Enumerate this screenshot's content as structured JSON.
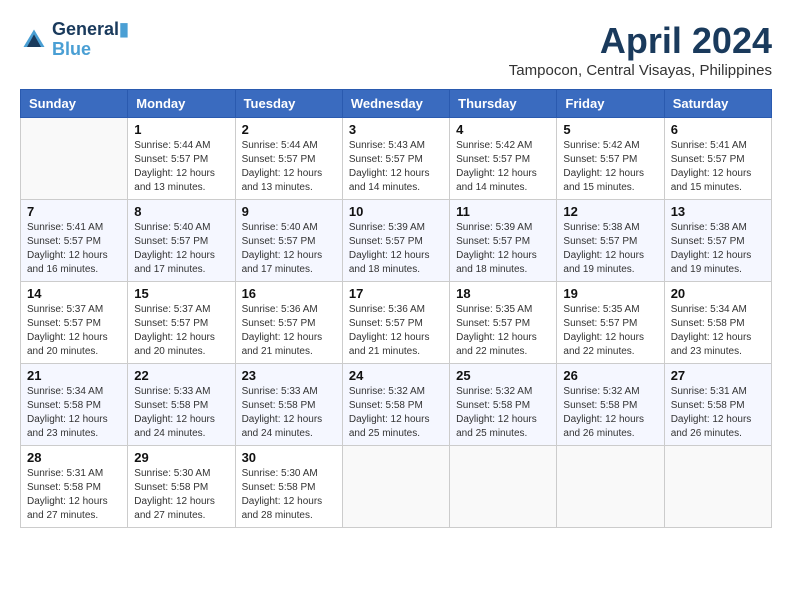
{
  "logo": {
    "line1": "General",
    "line2": "Blue"
  },
  "title": "April 2024",
  "subtitle": "Tampocon, Central Visayas, Philippines",
  "days_of_week": [
    "Sunday",
    "Monday",
    "Tuesday",
    "Wednesday",
    "Thursday",
    "Friday",
    "Saturday"
  ],
  "weeks": [
    [
      {
        "day": "",
        "info": ""
      },
      {
        "day": "1",
        "info": "Sunrise: 5:44 AM\nSunset: 5:57 PM\nDaylight: 12 hours\nand 13 minutes."
      },
      {
        "day": "2",
        "info": "Sunrise: 5:44 AM\nSunset: 5:57 PM\nDaylight: 12 hours\nand 13 minutes."
      },
      {
        "day": "3",
        "info": "Sunrise: 5:43 AM\nSunset: 5:57 PM\nDaylight: 12 hours\nand 14 minutes."
      },
      {
        "day": "4",
        "info": "Sunrise: 5:42 AM\nSunset: 5:57 PM\nDaylight: 12 hours\nand 14 minutes."
      },
      {
        "day": "5",
        "info": "Sunrise: 5:42 AM\nSunset: 5:57 PM\nDaylight: 12 hours\nand 15 minutes."
      },
      {
        "day": "6",
        "info": "Sunrise: 5:41 AM\nSunset: 5:57 PM\nDaylight: 12 hours\nand 15 minutes."
      }
    ],
    [
      {
        "day": "7",
        "info": "Sunrise: 5:41 AM\nSunset: 5:57 PM\nDaylight: 12 hours\nand 16 minutes."
      },
      {
        "day": "8",
        "info": "Sunrise: 5:40 AM\nSunset: 5:57 PM\nDaylight: 12 hours\nand 17 minutes."
      },
      {
        "day": "9",
        "info": "Sunrise: 5:40 AM\nSunset: 5:57 PM\nDaylight: 12 hours\nand 17 minutes."
      },
      {
        "day": "10",
        "info": "Sunrise: 5:39 AM\nSunset: 5:57 PM\nDaylight: 12 hours\nand 18 minutes."
      },
      {
        "day": "11",
        "info": "Sunrise: 5:39 AM\nSunset: 5:57 PM\nDaylight: 12 hours\nand 18 minutes."
      },
      {
        "day": "12",
        "info": "Sunrise: 5:38 AM\nSunset: 5:57 PM\nDaylight: 12 hours\nand 19 minutes."
      },
      {
        "day": "13",
        "info": "Sunrise: 5:38 AM\nSunset: 5:57 PM\nDaylight: 12 hours\nand 19 minutes."
      }
    ],
    [
      {
        "day": "14",
        "info": "Sunrise: 5:37 AM\nSunset: 5:57 PM\nDaylight: 12 hours\nand 20 minutes."
      },
      {
        "day": "15",
        "info": "Sunrise: 5:37 AM\nSunset: 5:57 PM\nDaylight: 12 hours\nand 20 minutes."
      },
      {
        "day": "16",
        "info": "Sunrise: 5:36 AM\nSunset: 5:57 PM\nDaylight: 12 hours\nand 21 minutes."
      },
      {
        "day": "17",
        "info": "Sunrise: 5:36 AM\nSunset: 5:57 PM\nDaylight: 12 hours\nand 21 minutes."
      },
      {
        "day": "18",
        "info": "Sunrise: 5:35 AM\nSunset: 5:57 PM\nDaylight: 12 hours\nand 22 minutes."
      },
      {
        "day": "19",
        "info": "Sunrise: 5:35 AM\nSunset: 5:57 PM\nDaylight: 12 hours\nand 22 minutes."
      },
      {
        "day": "20",
        "info": "Sunrise: 5:34 AM\nSunset: 5:58 PM\nDaylight: 12 hours\nand 23 minutes."
      }
    ],
    [
      {
        "day": "21",
        "info": "Sunrise: 5:34 AM\nSunset: 5:58 PM\nDaylight: 12 hours\nand 23 minutes."
      },
      {
        "day": "22",
        "info": "Sunrise: 5:33 AM\nSunset: 5:58 PM\nDaylight: 12 hours\nand 24 minutes."
      },
      {
        "day": "23",
        "info": "Sunrise: 5:33 AM\nSunset: 5:58 PM\nDaylight: 12 hours\nand 24 minutes."
      },
      {
        "day": "24",
        "info": "Sunrise: 5:32 AM\nSunset: 5:58 PM\nDaylight: 12 hours\nand 25 minutes."
      },
      {
        "day": "25",
        "info": "Sunrise: 5:32 AM\nSunset: 5:58 PM\nDaylight: 12 hours\nand 25 minutes."
      },
      {
        "day": "26",
        "info": "Sunrise: 5:32 AM\nSunset: 5:58 PM\nDaylight: 12 hours\nand 26 minutes."
      },
      {
        "day": "27",
        "info": "Sunrise: 5:31 AM\nSunset: 5:58 PM\nDaylight: 12 hours\nand 26 minutes."
      }
    ],
    [
      {
        "day": "28",
        "info": "Sunrise: 5:31 AM\nSunset: 5:58 PM\nDaylight: 12 hours\nand 27 minutes."
      },
      {
        "day": "29",
        "info": "Sunrise: 5:30 AM\nSunset: 5:58 PM\nDaylight: 12 hours\nand 27 minutes."
      },
      {
        "day": "30",
        "info": "Sunrise: 5:30 AM\nSunset: 5:58 PM\nDaylight: 12 hours\nand 28 minutes."
      },
      {
        "day": "",
        "info": ""
      },
      {
        "day": "",
        "info": ""
      },
      {
        "day": "",
        "info": ""
      },
      {
        "day": "",
        "info": ""
      }
    ]
  ]
}
